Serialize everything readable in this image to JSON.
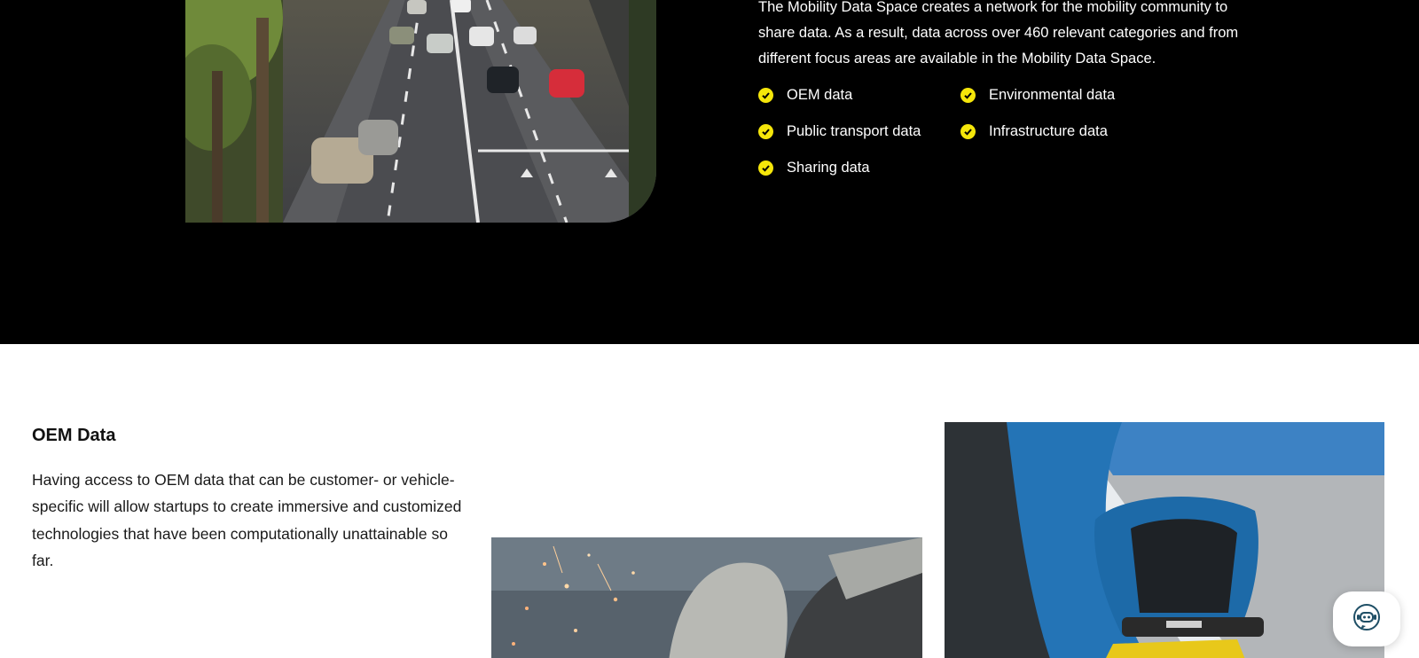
{
  "intro": {
    "text": "The Mobility Data Space creates a network for the mobility community to share data. As a result, data across over 460 relevant categories and from different focus areas are available in the Mobility Data Space."
  },
  "categories": [
    "OEM data",
    "Environmental data",
    "Public transport data",
    "Infrastructure data",
    "Sharing data"
  ],
  "oem": {
    "title": "OEM Data",
    "text": "Having access to OEM data that can be customer- or vehicle-specific will allow startups to create immersive and customized technologies that have been computationally unattainable so far."
  },
  "colors": {
    "dark_background": "#000000",
    "check_accent": "#f5e60a",
    "light_background": "#ffffff"
  },
  "icons": {
    "check": "check-circle-icon",
    "chat": "chatbot-icon"
  }
}
